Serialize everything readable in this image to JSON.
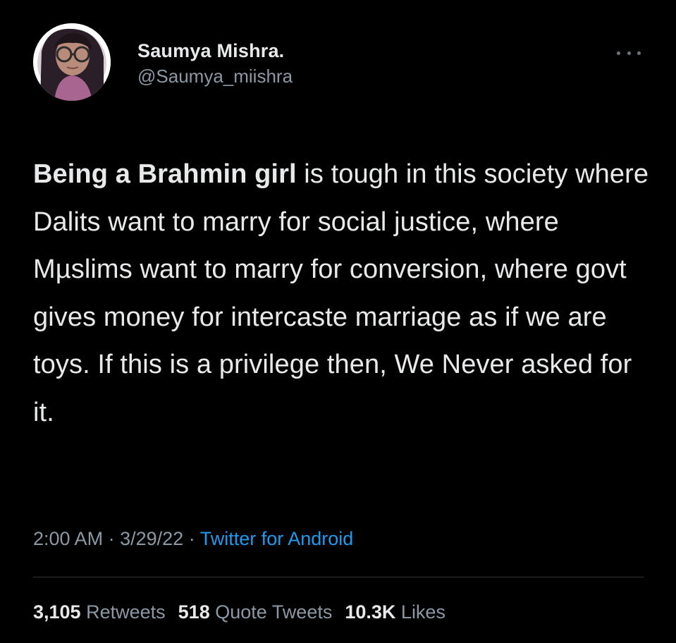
{
  "user": {
    "display_name": "Saumya Mishra.",
    "handle": "@Saumya_miishra"
  },
  "icons": {
    "avatar": "profile-photo",
    "more": "more-horizontal-icon"
  },
  "tweet": {
    "bold_text": "Being a Brahmin girl",
    "text": " is tough in this society where Dalits want to marry for social justice, where Mµslims want to marry for conversion, where govt gives money for intercaste marriage as if we are toys. If this is a privilege then, We Never asked for it."
  },
  "meta": {
    "time": "2:00 AM",
    "date": "3/29/22",
    "separator": "·",
    "source": "Twitter for Android"
  },
  "stats": {
    "retweets_count": "3,105",
    "retweets_label": "Retweets",
    "quotes_count": "518",
    "quotes_label": "Quote Tweets",
    "likes_count": "10.3K",
    "likes_label": "Likes"
  },
  "colors": {
    "background": "#000000",
    "text": "#e7e9ea",
    "secondary": "#8b98a5",
    "link": "#1d9bf0",
    "divider": "#2f3336"
  }
}
